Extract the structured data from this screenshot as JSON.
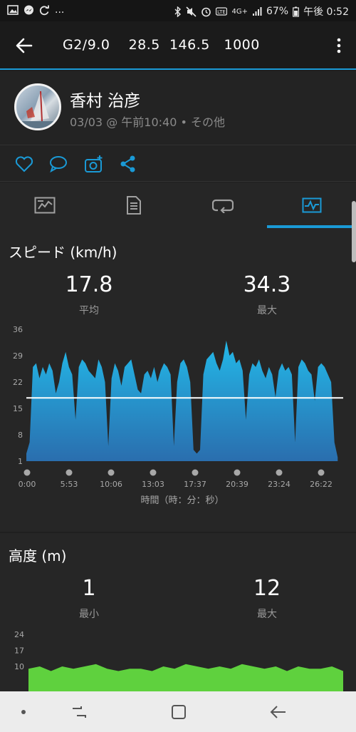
{
  "status_bar": {
    "left_icons": [
      "image-icon",
      "messenger-icon",
      "sync-icon"
    ],
    "ellipsis": "...",
    "lte_label": "4G+",
    "battery": "67%",
    "time": "午後 0:52"
  },
  "app_bar": {
    "title": "G2/9.0    28.5  146.5   1000"
  },
  "profile": {
    "name": "香村 治彦",
    "meta": "03/03 @ 午前10:40 • その他"
  },
  "actions": [
    "heart-icon",
    "comment-icon",
    "add-photo-icon",
    "share-icon"
  ],
  "tabs": [
    {
      "icon": "summary-icon",
      "selected": false
    },
    {
      "icon": "details-icon",
      "selected": false
    },
    {
      "icon": "laps-icon",
      "selected": false
    },
    {
      "icon": "charts-icon",
      "selected": true
    }
  ],
  "colors": {
    "accent": "#1a9ad6",
    "chart_fill_top": "#23b8e8",
    "chart_fill_bottom": "#2a7ab8",
    "altitude_fill": "#5fd13e"
  },
  "speed": {
    "title": "スピード (km/h)",
    "avg_value": "17.8",
    "avg_label": "平均",
    "max_value": "34.3",
    "max_label": "最大",
    "x_axis_label": "時間（時：分：秒）"
  },
  "altitude": {
    "title": "高度 (m)",
    "min_value": "1",
    "min_label": "最小",
    "max_value": "12",
    "max_label": "最大"
  },
  "chart_data": [
    {
      "type": "area",
      "title": "スピード (km/h)",
      "xlabel": "時間（時：分：秒）",
      "ylabel": "",
      "yticks": [
        "36",
        "29",
        "22",
        "15",
        "8",
        "1"
      ],
      "ylim": [
        1,
        36
      ],
      "xticks": [
        "0:00",
        "5:53",
        "10:06",
        "13:03",
        "17:37",
        "20:39",
        "23:24",
        "26:22"
      ],
      "xlim_minutes": [
        0,
        29
      ],
      "average_line": 17.8,
      "x_minutes": [
        0,
        0.3,
        0.6,
        0.9,
        1.2,
        1.5,
        1.8,
        2.1,
        2.4,
        2.7,
        3.0,
        3.3,
        3.6,
        3.9,
        4.2,
        4.5,
        4.8,
        5.1,
        5.4,
        5.7,
        6.0,
        6.3,
        6.6,
        6.9,
        7.2,
        7.5,
        7.8,
        8.1,
        8.4,
        8.7,
        9.0,
        9.3,
        9.6,
        9.9,
        10.2,
        10.5,
        10.8,
        11.1,
        11.4,
        11.7,
        12.0,
        12.3,
        12.6,
        12.9,
        13.2,
        13.5,
        13.8,
        14.1,
        14.4,
        14.7,
        15.0,
        15.3,
        15.6,
        15.9,
        16.2,
        16.5,
        16.8,
        17.1,
        17.4,
        17.7,
        18.0,
        18.3,
        18.6,
        18.9,
        19.2,
        19.5,
        19.8,
        20.1,
        20.4,
        20.7,
        21.0,
        21.3,
        21.6,
        21.9,
        22.2,
        22.5,
        22.8,
        23.1,
        23.4,
        23.7,
        24.0,
        24.3,
        24.6,
        24.9,
        25.2,
        25.5,
        25.8,
        26.1,
        26.4,
        26.7,
        27.0,
        27.3,
        27.6,
        27.9,
        28.2,
        28.5
      ],
      "values": [
        3,
        6,
        26,
        27,
        23,
        26,
        24,
        27,
        25,
        19,
        22,
        27,
        30,
        26,
        24,
        12,
        26,
        28,
        27,
        25,
        24,
        23,
        28,
        26,
        22,
        5,
        23,
        27,
        25,
        21,
        26,
        27,
        28,
        24,
        20,
        19,
        24,
        25,
        23,
        26,
        22,
        25,
        27,
        26,
        24,
        5,
        22,
        27,
        28,
        26,
        22,
        4,
        3,
        4,
        24,
        28,
        29,
        30,
        27,
        25,
        28,
        33,
        29,
        30,
        27,
        28,
        25,
        12,
        24,
        27,
        26,
        28,
        25,
        23,
        26,
        24,
        18,
        25,
        27,
        25,
        26,
        24,
        6,
        26,
        28,
        27,
        25,
        24,
        17,
        26,
        27,
        26,
        24,
        22,
        6,
        2
      ]
    },
    {
      "type": "area",
      "title": "高度 (m)",
      "yticks": [
        "24",
        "17",
        "10"
      ],
      "ylim": [
        1,
        24
      ],
      "x_minutes": [
        0,
        1,
        2,
        3,
        4,
        5,
        6,
        7,
        8,
        9,
        10,
        11,
        12,
        13,
        14,
        15,
        16,
        17,
        18,
        19,
        20,
        21,
        22,
        23,
        24,
        25,
        26,
        27,
        28
      ],
      "values": [
        9,
        10,
        8,
        10,
        9,
        10,
        11,
        9,
        8,
        9,
        9,
        8,
        10,
        9,
        11,
        10,
        9,
        10,
        9,
        11,
        10,
        9,
        10,
        8,
        10,
        9,
        9,
        10,
        8
      ]
    }
  ],
  "nav_bar": [
    "dot-icon",
    "recents-icon",
    "home-icon",
    "back-nav-icon"
  ]
}
